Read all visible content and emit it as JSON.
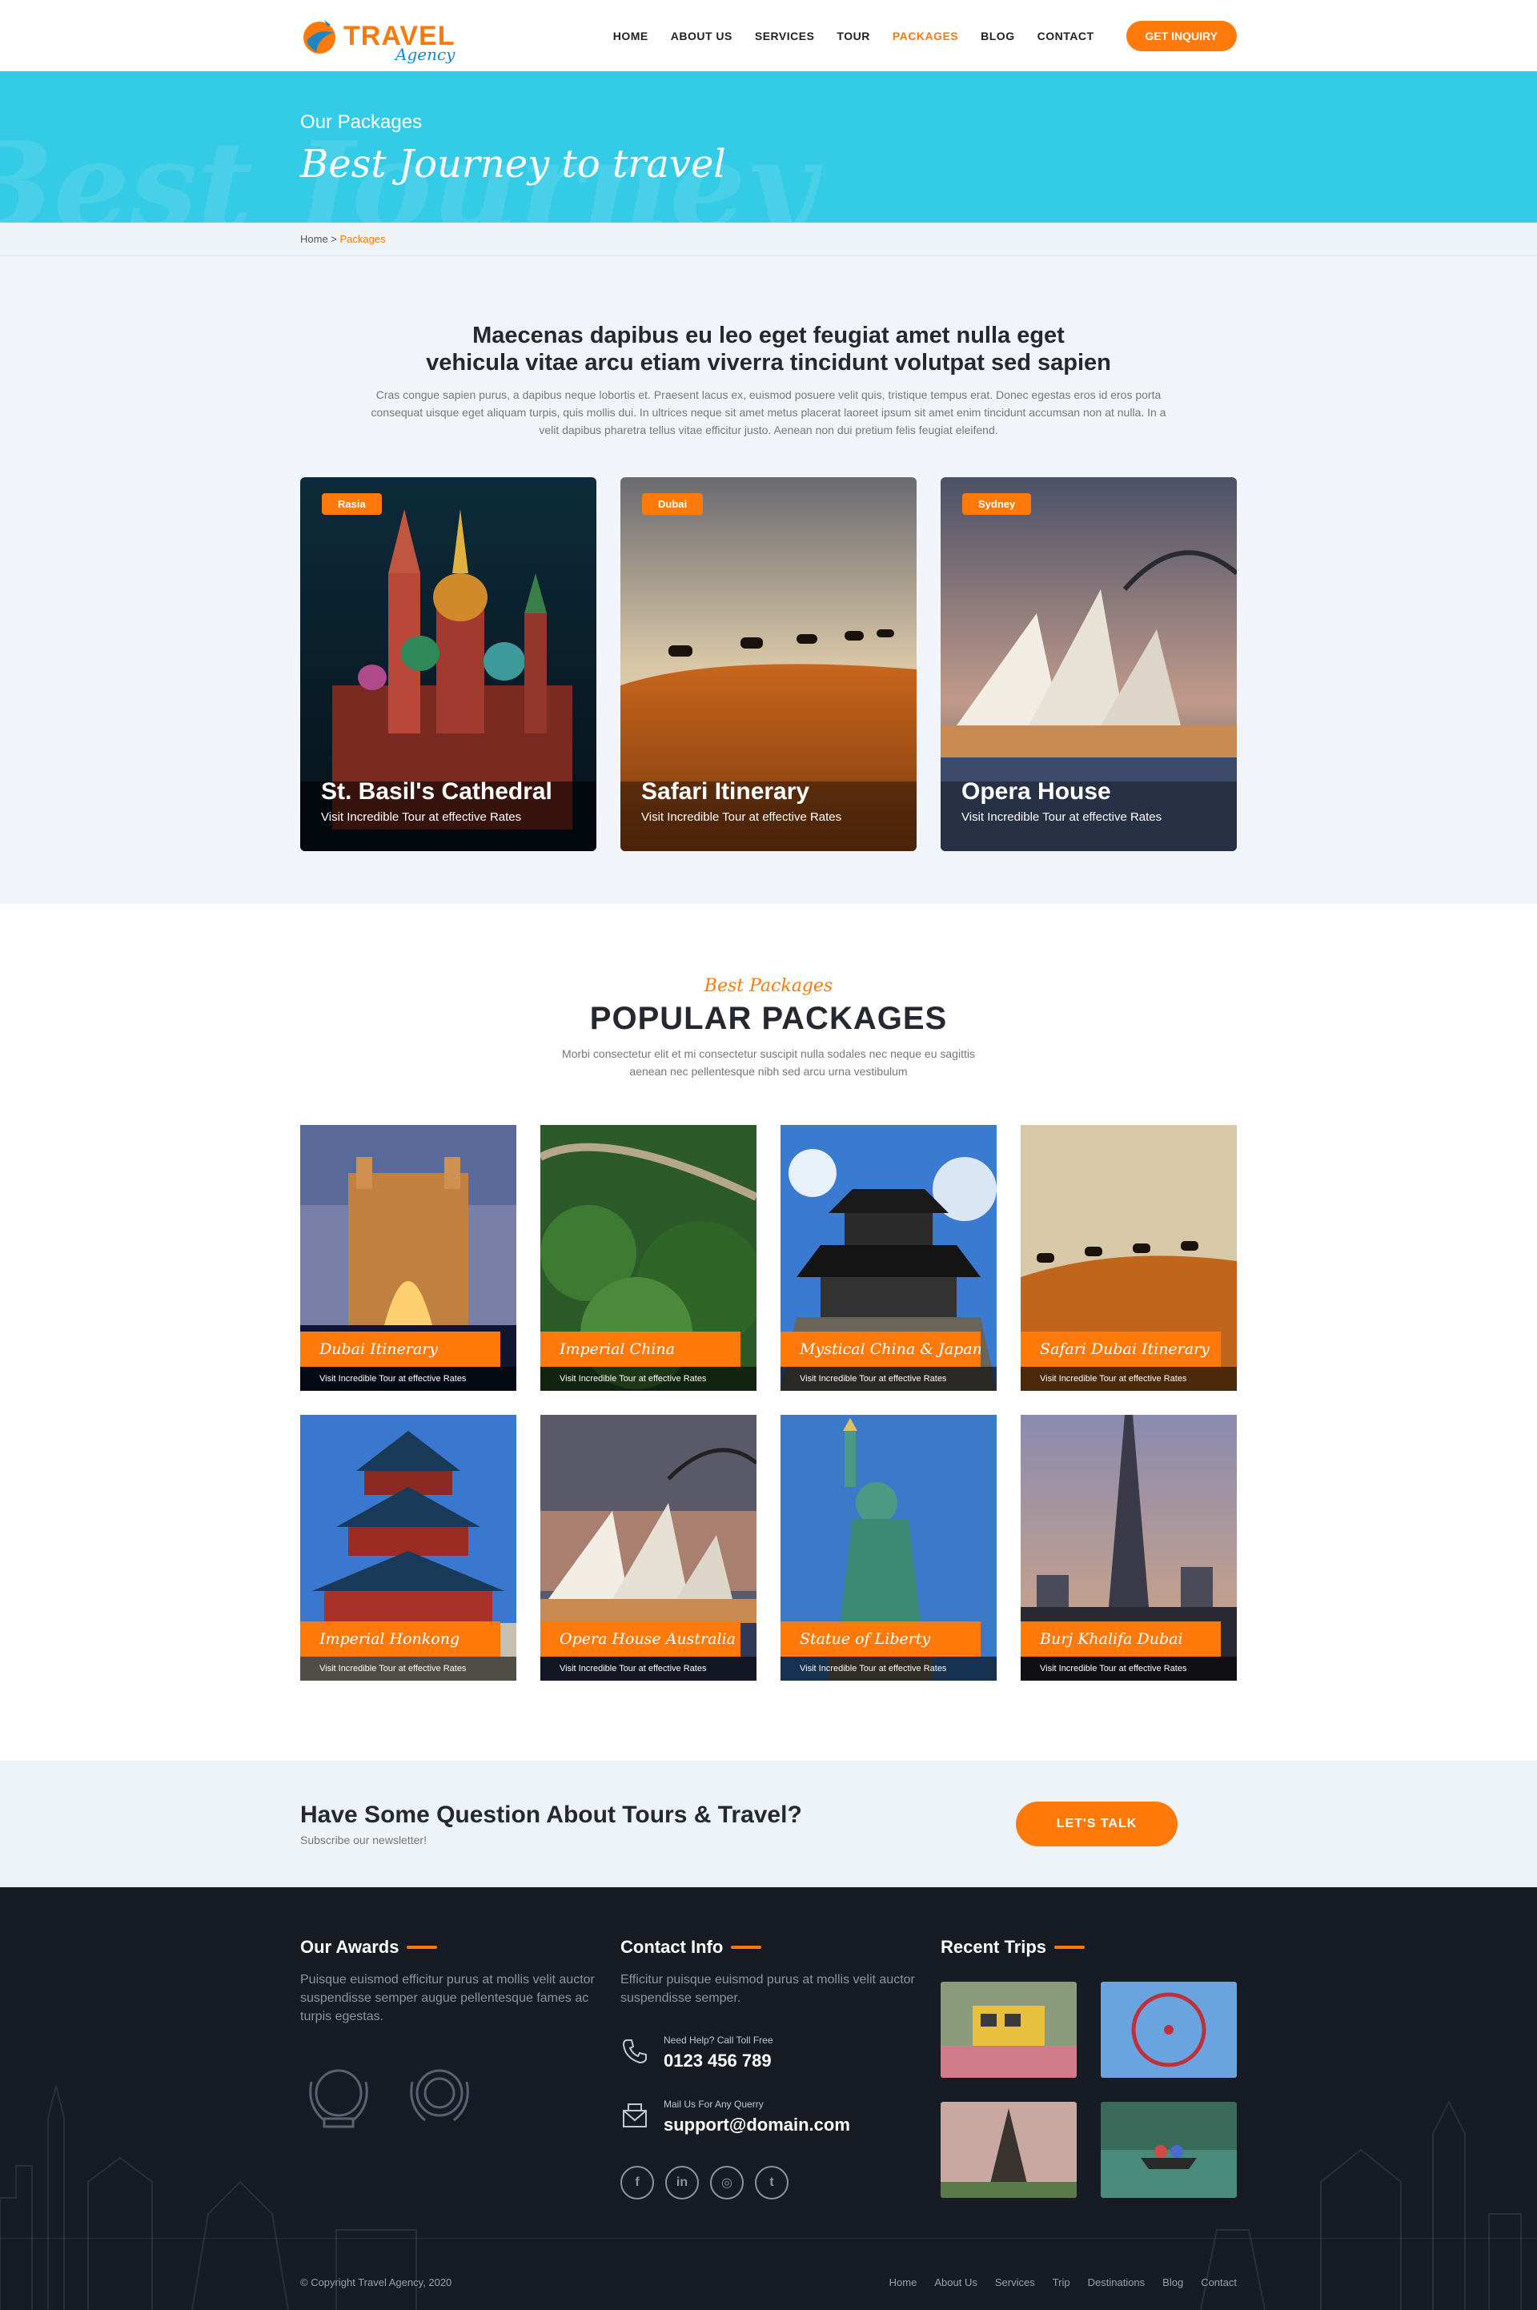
{
  "brand": {
    "name": "TRAVEL",
    "sub": "Agency"
  },
  "nav": [
    {
      "label": "HOME"
    },
    {
      "label": "ABOUT US"
    },
    {
      "label": "SERVICES"
    },
    {
      "label": "TOUR"
    },
    {
      "label": "PACKAGES",
      "active": true
    },
    {
      "label": "BLOG"
    },
    {
      "label": "CONTACT"
    }
  ],
  "header": {
    "inquiry_label": "GET INQUIRY"
  },
  "hero": {
    "subtitle": "Our Packages",
    "title": "Best Journey to travel",
    "ghost": "Best Journey"
  },
  "breadcrumb": {
    "home": "Home",
    "sep": " > ",
    "current": "Packages"
  },
  "intro": {
    "title_line1": "Maecenas dapibus eu leo eget feugiat amet nulla eget",
    "title_line2": "vehicula vitae arcu etiam viverra tincidunt volutpat sed sapien",
    "text": "Cras congue sapien purus, a dapibus neque lobortis et. Praesent lacus ex, euismod posuere velit quis, tristique tempus erat. Donec egestas eros id eros porta consequat uisque eget aliquam turpis, quis mollis dui. In ultrices neque sit amet metus placerat laoreet ipsum sit amet enim tincidunt accumsan non at nulla. In a velit dapibus pharetra tellus vitae efficitur justo. Aenean non dui pretium felis feugiat eleifend."
  },
  "features": [
    {
      "tag": "Rasia",
      "title": "St. Basil's Cathedral",
      "desc": "Visit Incredible Tour at effective Rates"
    },
    {
      "tag": "Dubai",
      "title": "Safari Itinerary",
      "desc": "Visit Incredible Tour at effective Rates"
    },
    {
      "tag": "Sydney",
      "title": "Opera House",
      "desc": "Visit Incredible Tour at effective Rates"
    }
  ],
  "popular": {
    "script": "Best Packages",
    "title": "POPULAR PACKAGES",
    "text": "Morbi consectetur elit et mi consectetur suscipit nulla sodales nec neque eu sagittis aenean nec pellentesque nibh sed arcu urna vestibulum",
    "items": [
      {
        "title": "Dubai Itinerary",
        "sub": "Visit Incredible Tour at effective Rates"
      },
      {
        "title": "Imperial China",
        "sub": "Visit Incredible Tour at effective Rates"
      },
      {
        "title": "Mystical China & Japan",
        "sub": "Visit Incredible Tour at effective Rates"
      },
      {
        "title": "Safari Dubai Itinerary",
        "sub": "Visit Incredible Tour at effective Rates"
      },
      {
        "title": "Imperial Honkong",
        "sub": "Visit Incredible Tour at effective Rates"
      },
      {
        "title": "Opera House Australia",
        "sub": "Visit Incredible Tour at effective Rates"
      },
      {
        "title": "Statue of Liberty",
        "sub": "Visit Incredible Tour at effective Rates"
      },
      {
        "title": "Burj Khalifa Dubai",
        "sub": "Visit Incredible Tour at effective Rates"
      }
    ]
  },
  "cta": {
    "title": "Have Some Question About Tours & Travel?",
    "sub": "Subscribe our newsletter!",
    "button": "LET'S TALK"
  },
  "footer": {
    "awards": {
      "title": "Our Awards",
      "text": "Puisque euismod efficitur purus at mollis velit auctor suspendisse semper augue pellentesque fames ac turpis egestas."
    },
    "contact": {
      "title": "Contact Info",
      "text": "Efficitur puisque euismod purus at mollis velit auctor suspendisse semper.",
      "phone_label": "Need Help? Call Toll Free",
      "phone": "0123 456 789",
      "mail_label": "Mail Us For Any Querry",
      "mail": "support@domain.com"
    },
    "trips": {
      "title": "Recent Trips"
    },
    "copyright": "© Copyright Travel Agency, 2020",
    "links": [
      {
        "label": "Home"
      },
      {
        "label": "About Us"
      },
      {
        "label": "Services"
      },
      {
        "label": "Trip"
      },
      {
        "label": "Destinations"
      },
      {
        "label": "Blog"
      },
      {
        "label": "Contact"
      }
    ]
  },
  "colors": {
    "accent": "#ff7a0a",
    "hero": "#33cbe6",
    "footer": "#171b24",
    "light": "#f1f5fa"
  },
  "icons": [
    "logo-icon",
    "phone-icon",
    "mail-icon",
    "facebook-icon",
    "linkedin-icon",
    "instagram-icon",
    "twitter-icon",
    "award-badge-icon"
  ]
}
